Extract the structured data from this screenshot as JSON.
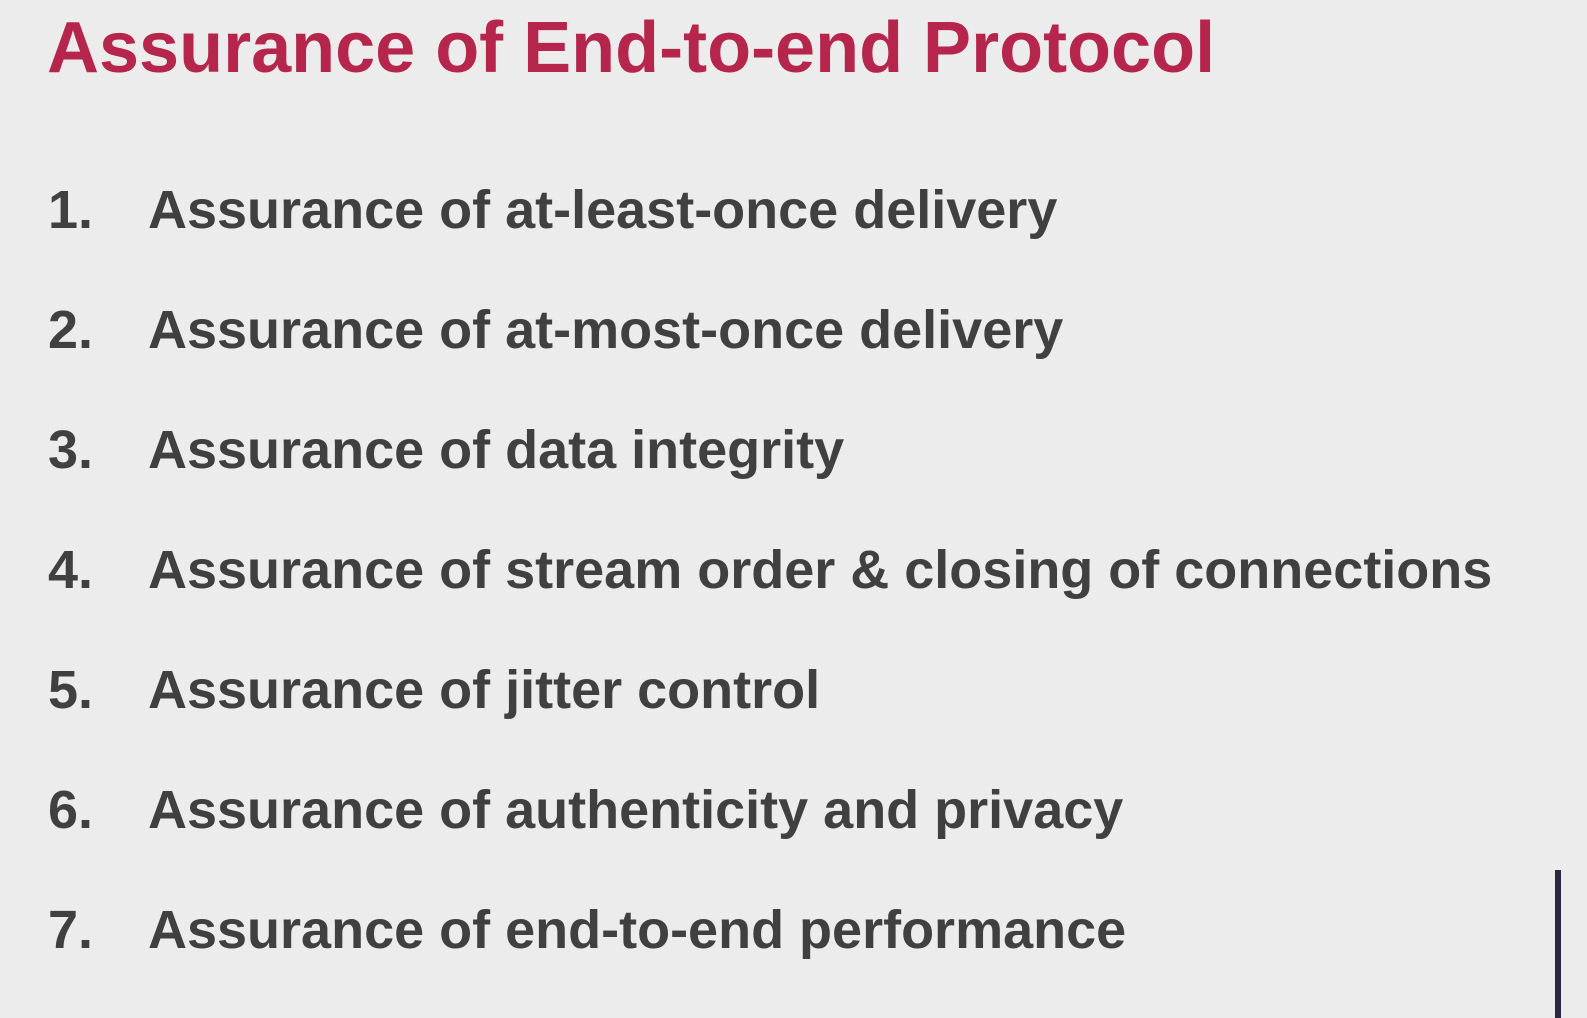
{
  "slide": {
    "title": "Assurance of End-to-end Protocol",
    "title_color": "#b5254c",
    "text_color": "#404040",
    "background_color": "#ececec",
    "items": [
      {
        "number": "1.",
        "text": "Assurance of at-least-once delivery"
      },
      {
        "number": "2.",
        "text": "Assurance of at-most-once delivery"
      },
      {
        "number": "3.",
        "text": "Assurance of data integrity"
      },
      {
        "number": "4.",
        "text": "Assurance of stream order & closing of connections"
      },
      {
        "number": "5.",
        "text": "Assurance of jitter control"
      },
      {
        "number": "6.",
        "text": "Assurance of authenticity and privacy"
      },
      {
        "number": "7.",
        "text": "Assurance of end-to-end performance"
      }
    ]
  }
}
